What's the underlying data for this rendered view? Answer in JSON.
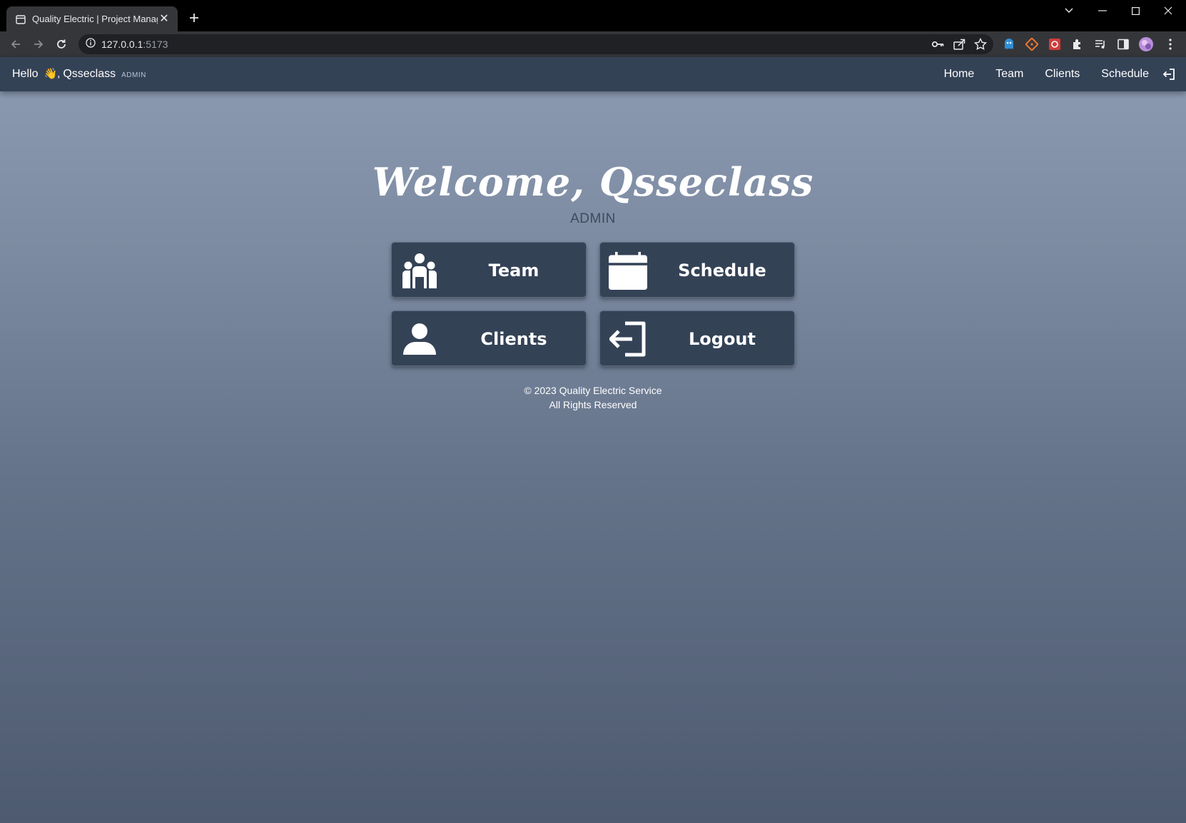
{
  "browser": {
    "tab_title": "Quality Electric | Project Manager",
    "url_host": "127.0.0.1",
    "url_port": ":5173"
  },
  "navbar": {
    "greeting": "Hello",
    "wave": "👋,",
    "username": "Qsseclass",
    "role": "ADMIN",
    "links": [
      "Home",
      "Team",
      "Clients",
      "Schedule"
    ]
  },
  "main": {
    "welcome": "Welcome, Qsseclass",
    "role": "ADMIN",
    "cards": [
      {
        "label": "Team",
        "icon": "team-icon"
      },
      {
        "label": "Schedule",
        "icon": "calendar-icon"
      },
      {
        "label": "Clients",
        "icon": "user-icon"
      },
      {
        "label": "Logout",
        "icon": "logout-icon"
      }
    ]
  },
  "footer": {
    "line1": "© 2023 Quality Electric Service",
    "line2": "All Rights Reserved"
  },
  "colors": {
    "navbar": "#344256",
    "card": "#344256",
    "bg_top": "#8c9bb2",
    "bg_bottom": "#4d5a70"
  }
}
